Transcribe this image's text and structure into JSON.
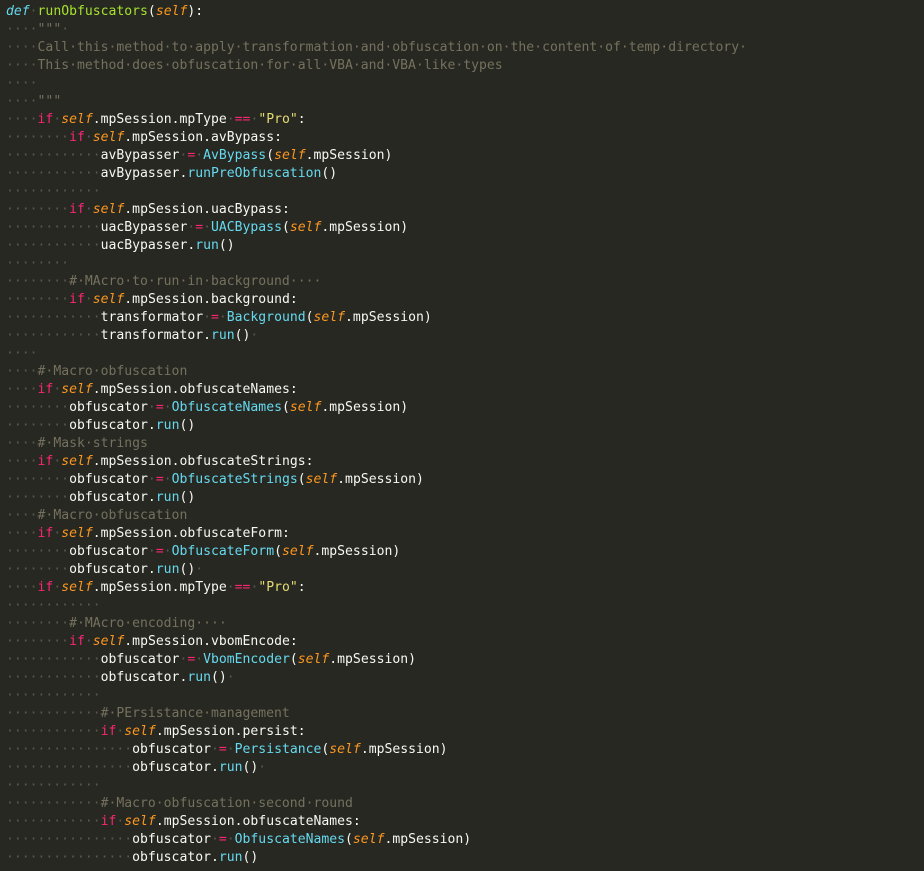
{
  "editor": {
    "theme": {
      "background": "#272822",
      "text": "#f8f8f2",
      "keyword": "#f92672",
      "self": "#fd971f",
      "function": "#a6e22e",
      "class_call": "#66d9ef",
      "string": "#e6db74",
      "comment": "#75715e",
      "whitespace_marker": "#57584f"
    },
    "lines": [
      [
        [
          "dec",
          "def"
        ],
        [
          "ws",
          "·"
        ],
        [
          "fn",
          "runObfuscators"
        ],
        [
          "id",
          "("
        ],
        [
          "slf",
          "self"
        ],
        [
          "id",
          "):"
        ]
      ],
      [
        [
          "ws",
          "····"
        ],
        [
          "cm",
          "\"\"\""
        ],
        [
          "ws",
          "·"
        ]
      ],
      [
        [
          "ws",
          "····"
        ],
        [
          "cm",
          "Call·this·method·to·apply·transformation·and·obfuscation·on·the·content·of·temp·directory·"
        ]
      ],
      [
        [
          "ws",
          "····"
        ],
        [
          "cm",
          "This·method·does·obfuscation·for·all·VBA·and·VBA·like·types"
        ]
      ],
      [
        [
          "ws",
          "····"
        ]
      ],
      [
        [
          "ws",
          "····"
        ],
        [
          "cm",
          "\"\"\""
        ]
      ],
      [
        [
          "ws",
          "····"
        ],
        [
          "kw",
          "if"
        ],
        [
          "ws",
          "·"
        ],
        [
          "slf",
          "self"
        ],
        [
          "id",
          ".mpSession.mpType"
        ],
        [
          "ws",
          "·"
        ],
        [
          "op",
          "=="
        ],
        [
          "ws",
          "·"
        ],
        [
          "str",
          "\"Pro\""
        ],
        [
          "id",
          ":"
        ]
      ],
      [
        [
          "ws",
          "········"
        ],
        [
          "kw",
          "if"
        ],
        [
          "ws",
          "·"
        ],
        [
          "slf",
          "self"
        ],
        [
          "id",
          ".mpSession.avBypass:"
        ]
      ],
      [
        [
          "ws",
          "············"
        ],
        [
          "id",
          "avBypasser"
        ],
        [
          "ws",
          "·"
        ],
        [
          "op",
          "="
        ],
        [
          "ws",
          "·"
        ],
        [
          "cls",
          "AvBypass"
        ],
        [
          "id",
          "("
        ],
        [
          "slf",
          "self"
        ],
        [
          "id",
          ".mpSession)"
        ]
      ],
      [
        [
          "ws",
          "············"
        ],
        [
          "id",
          "avBypasser."
        ],
        [
          "cls",
          "runPreObfuscation"
        ],
        [
          "id",
          "()"
        ]
      ],
      [
        [
          "ws",
          "············"
        ]
      ],
      [
        [
          "ws",
          "········"
        ],
        [
          "kw",
          "if"
        ],
        [
          "ws",
          "·"
        ],
        [
          "slf",
          "self"
        ],
        [
          "id",
          ".mpSession.uacBypass:"
        ]
      ],
      [
        [
          "ws",
          "············"
        ],
        [
          "id",
          "uacBypasser"
        ],
        [
          "ws",
          "·"
        ],
        [
          "op",
          "="
        ],
        [
          "ws",
          "·"
        ],
        [
          "cls",
          "UACBypass"
        ],
        [
          "id",
          "("
        ],
        [
          "slf",
          "self"
        ],
        [
          "id",
          ".mpSession)"
        ]
      ],
      [
        [
          "ws",
          "············"
        ],
        [
          "id",
          "uacBypasser."
        ],
        [
          "cls",
          "run"
        ],
        [
          "id",
          "()"
        ]
      ],
      [
        [
          "ws",
          "········"
        ]
      ],
      [
        [
          "ws",
          "········"
        ],
        [
          "cm",
          "#·MAcro·to·run·in·background····"
        ]
      ],
      [
        [
          "ws",
          "········"
        ],
        [
          "kw",
          "if"
        ],
        [
          "ws",
          "·"
        ],
        [
          "slf",
          "self"
        ],
        [
          "id",
          ".mpSession.background:"
        ]
      ],
      [
        [
          "ws",
          "············"
        ],
        [
          "id",
          "transformator"
        ],
        [
          "ws",
          "·"
        ],
        [
          "op",
          "="
        ],
        [
          "ws",
          "·"
        ],
        [
          "cls",
          "Background"
        ],
        [
          "id",
          "("
        ],
        [
          "slf",
          "self"
        ],
        [
          "id",
          ".mpSession)"
        ]
      ],
      [
        [
          "ws",
          "············"
        ],
        [
          "id",
          "transformator."
        ],
        [
          "cls",
          "run"
        ],
        [
          "id",
          "()"
        ],
        [
          "ws",
          "·"
        ]
      ],
      [
        [
          "ws",
          "····"
        ]
      ],
      [
        [
          "ws",
          "····"
        ],
        [
          "cm",
          "#·Macro·obfuscation"
        ]
      ],
      [
        [
          "ws",
          "····"
        ],
        [
          "kw",
          "if"
        ],
        [
          "ws",
          "·"
        ],
        [
          "slf",
          "self"
        ],
        [
          "id",
          ".mpSession.obfuscateNames:"
        ]
      ],
      [
        [
          "ws",
          "········"
        ],
        [
          "id",
          "obfuscator"
        ],
        [
          "ws",
          "·"
        ],
        [
          "op",
          "="
        ],
        [
          "ws",
          "·"
        ],
        [
          "cls",
          "ObfuscateNames"
        ],
        [
          "id",
          "("
        ],
        [
          "slf",
          "self"
        ],
        [
          "id",
          ".mpSession)"
        ]
      ],
      [
        [
          "ws",
          "········"
        ],
        [
          "id",
          "obfuscator."
        ],
        [
          "cls",
          "run"
        ],
        [
          "id",
          "()"
        ]
      ],
      [
        [
          "ws",
          "····"
        ],
        [
          "cm",
          "#·Mask·strings"
        ]
      ],
      [
        [
          "ws",
          "····"
        ],
        [
          "kw",
          "if"
        ],
        [
          "ws",
          "·"
        ],
        [
          "slf",
          "self"
        ],
        [
          "id",
          ".mpSession.obfuscateStrings:"
        ]
      ],
      [
        [
          "ws",
          "········"
        ],
        [
          "id",
          "obfuscator"
        ],
        [
          "ws",
          "·"
        ],
        [
          "op",
          "="
        ],
        [
          "ws",
          "·"
        ],
        [
          "cls",
          "ObfuscateStrings"
        ],
        [
          "id",
          "("
        ],
        [
          "slf",
          "self"
        ],
        [
          "id",
          ".mpSession)"
        ]
      ],
      [
        [
          "ws",
          "········"
        ],
        [
          "id",
          "obfuscator."
        ],
        [
          "cls",
          "run"
        ],
        [
          "id",
          "()"
        ]
      ],
      [
        [
          "ws",
          "····"
        ],
        [
          "cm",
          "#·Macro·obfuscation"
        ]
      ],
      [
        [
          "ws",
          "····"
        ],
        [
          "kw",
          "if"
        ],
        [
          "ws",
          "·"
        ],
        [
          "slf",
          "self"
        ],
        [
          "id",
          ".mpSession.obfuscateForm:"
        ]
      ],
      [
        [
          "ws",
          "········"
        ],
        [
          "id",
          "obfuscator"
        ],
        [
          "ws",
          "·"
        ],
        [
          "op",
          "="
        ],
        [
          "ws",
          "·"
        ],
        [
          "cls",
          "ObfuscateForm"
        ],
        [
          "id",
          "("
        ],
        [
          "slf",
          "self"
        ],
        [
          "id",
          ".mpSession)"
        ]
      ],
      [
        [
          "ws",
          "········"
        ],
        [
          "id",
          "obfuscator."
        ],
        [
          "cls",
          "run"
        ],
        [
          "id",
          "()"
        ],
        [
          "ws",
          "·"
        ]
      ],
      [
        [
          "ws",
          "····"
        ],
        [
          "kw",
          "if"
        ],
        [
          "ws",
          "·"
        ],
        [
          "slf",
          "self"
        ],
        [
          "id",
          ".mpSession.mpType"
        ],
        [
          "ws",
          "·"
        ],
        [
          "op",
          "=="
        ],
        [
          "ws",
          "·"
        ],
        [
          "str",
          "\"Pro\""
        ],
        [
          "id",
          ":"
        ]
      ],
      [
        [
          "ws",
          "············"
        ]
      ],
      [
        [
          "ws",
          "········"
        ],
        [
          "cm",
          "#·MAcro·encoding····"
        ]
      ],
      [
        [
          "ws",
          "········"
        ],
        [
          "kw",
          "if"
        ],
        [
          "ws",
          "·"
        ],
        [
          "slf",
          "self"
        ],
        [
          "id",
          ".mpSession.vbomEncode:"
        ]
      ],
      [
        [
          "ws",
          "············"
        ],
        [
          "id",
          "obfuscator"
        ],
        [
          "ws",
          "·"
        ],
        [
          "op",
          "="
        ],
        [
          "ws",
          "·"
        ],
        [
          "cls",
          "VbomEncoder"
        ],
        [
          "id",
          "("
        ],
        [
          "slf",
          "self"
        ],
        [
          "id",
          ".mpSession)"
        ]
      ],
      [
        [
          "ws",
          "············"
        ],
        [
          "id",
          "obfuscator."
        ],
        [
          "cls",
          "run"
        ],
        [
          "id",
          "()"
        ],
        [
          "ws",
          "·"
        ]
      ],
      [
        [
          "ws",
          "············"
        ]
      ],
      [
        [
          "ws",
          "············"
        ],
        [
          "cm",
          "#·PErsistance·management"
        ]
      ],
      [
        [
          "ws",
          "············"
        ],
        [
          "kw",
          "if"
        ],
        [
          "ws",
          "·"
        ],
        [
          "slf",
          "self"
        ],
        [
          "id",
          ".mpSession.persist:"
        ]
      ],
      [
        [
          "ws",
          "················"
        ],
        [
          "id",
          "obfuscator"
        ],
        [
          "ws",
          "·"
        ],
        [
          "op",
          "="
        ],
        [
          "ws",
          "·"
        ],
        [
          "cls",
          "Persistance"
        ],
        [
          "id",
          "("
        ],
        [
          "slf",
          "self"
        ],
        [
          "id",
          ".mpSession)"
        ]
      ],
      [
        [
          "ws",
          "················"
        ],
        [
          "id",
          "obfuscator."
        ],
        [
          "cls",
          "run"
        ],
        [
          "id",
          "()"
        ],
        [
          "ws",
          "·"
        ]
      ],
      [
        [
          "ws",
          "············"
        ]
      ],
      [
        [
          "ws",
          "············"
        ],
        [
          "cm",
          "#·Macro·obfuscation·second·round"
        ]
      ],
      [
        [
          "ws",
          "············"
        ],
        [
          "kw",
          "if"
        ],
        [
          "ws",
          "·"
        ],
        [
          "slf",
          "self"
        ],
        [
          "id",
          ".mpSession.obfuscateNames:"
        ]
      ],
      [
        [
          "ws",
          "················"
        ],
        [
          "id",
          "obfuscator"
        ],
        [
          "ws",
          "·"
        ],
        [
          "op",
          "="
        ],
        [
          "ws",
          "·"
        ],
        [
          "cls",
          "ObfuscateNames"
        ],
        [
          "id",
          "("
        ],
        [
          "slf",
          "self"
        ],
        [
          "id",
          ".mpSession)"
        ]
      ],
      [
        [
          "ws",
          "················"
        ],
        [
          "id",
          "obfuscator."
        ],
        [
          "cls",
          "run"
        ],
        [
          "id",
          "()"
        ]
      ]
    ]
  }
}
